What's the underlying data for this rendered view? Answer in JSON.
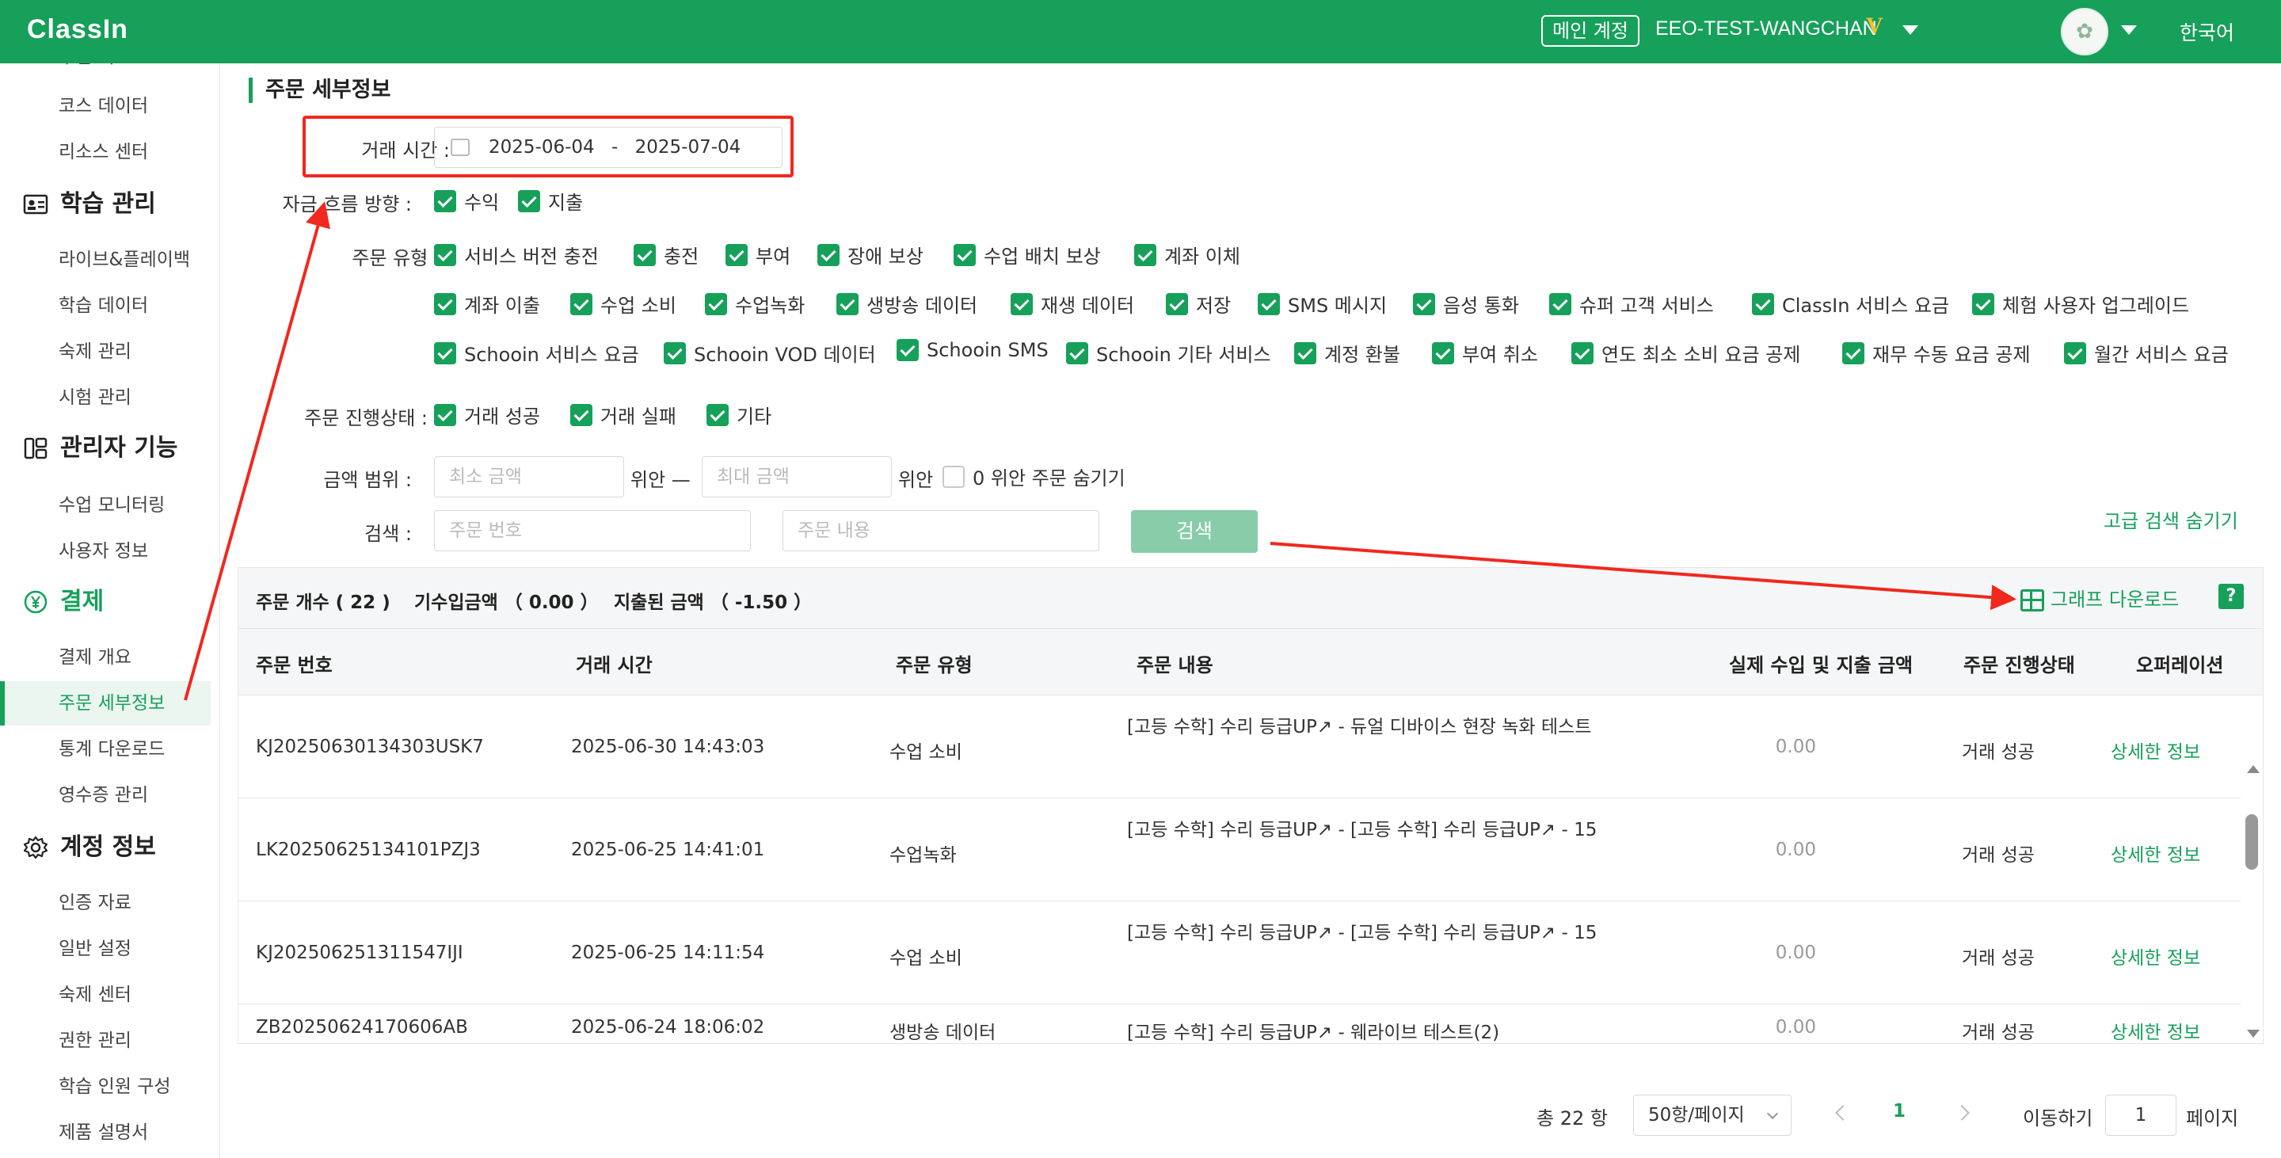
{
  "header": {
    "logo": "ClassIn",
    "main_account_badge": "메인 계정",
    "account_name": "EEO-TEST-WANGCHAN",
    "vip_badge": "V",
    "language": "한국어"
  },
  "sidebar": {
    "top_partial": "수업 리스트",
    "items_a": [
      "코스 데이터",
      "리소스 센터"
    ],
    "section_learning": "학습 관리",
    "items_learning": [
      "라이브&플레이백",
      "학습 데이터",
      "숙제 관리",
      "시험 관리"
    ],
    "section_admin": "관리자 기능",
    "items_admin": [
      "수업 모니터링",
      "사용자 정보"
    ],
    "section_payment": "결제",
    "items_payment": [
      "결제 개요",
      "주문 세부정보",
      "통계 다운로드",
      "영수증 관리"
    ],
    "section_account": "계정 정보",
    "items_account": [
      "인증 자료",
      "일반 설정",
      "숙제 센터",
      "권한 관리",
      "학습 인원 구성",
      "제품 설명서"
    ]
  },
  "filters": {
    "section_title": "주문 세부정보",
    "trade_time_label": "거래 시간 :",
    "date_start": "2025-06-04",
    "date_sep": "-",
    "date_end": "2025-07-04",
    "flow_label": "자금 흐름 방향 :",
    "flow_options": [
      "수익",
      "지출"
    ],
    "type_label": "주문 유형 :",
    "type_row1": [
      "서비스 버전 충전",
      "충전",
      "부여",
      "장애 보상",
      "수업 배치 보상",
      "계좌 이체"
    ],
    "type_row2": [
      "계좌 이출",
      "수업 소비",
      "수업녹화",
      "생방송 데이터",
      "재생 데이터",
      "저장",
      "SMS 메시지",
      "음성 통화",
      "슈퍼 고객 서비스",
      "ClassIn 서비스 요금",
      "체험 사용자 업그레이드"
    ],
    "type_row3": [
      "Schooin 서비스 요금",
      "Schooin VOD 데이터",
      "Schooin SMS",
      "Schooin 기타 서비스",
      "계정 환불",
      "부여 취소",
      "연도 최소 소비 요금 공제",
      "재무 수동 요금 공제",
      "월간 서비스 요금"
    ],
    "status_label": "주문 진행상태 :",
    "status_options": [
      "거래 성공",
      "거래 실패",
      "기타"
    ],
    "amount_label": "금액 범위 :",
    "min_placeholder": "최소 금액",
    "unit1": "위안 —",
    "max_placeholder": "최대 금액",
    "unit2": "위안",
    "hide_zero": "0 위안 주문 숨기기",
    "search_label": "검색 :",
    "order_no_placeholder": "주문 번호",
    "order_content_placeholder": "주문 내용",
    "search_button": "검색",
    "hide_advanced": "고급 검색 숨기기"
  },
  "summary": {
    "count": "주문 개수 ( 22 )",
    "prepaid": "기수입금액 （ 0.00 ）",
    "spent": "지출된 금액 （ -1.50 ）",
    "download": "그래프 다운로드",
    "help": "?"
  },
  "table": {
    "headers": [
      "주문 번호",
      "거래 시간",
      "주문 유형",
      "주문 내용",
      "실제 수입 및 지출 금액",
      "주문 진행상태",
      "오퍼레이션"
    ],
    "rows": [
      {
        "no": "KJ20250630134303USK7",
        "time": "2025-06-30 14:43:03",
        "type": "수업 소비",
        "content": "[고등 수학] 수리 등급UP↗ - 듀얼 디바이스 현장 녹화 테스트",
        "amount": "0.00",
        "status": "거래 성공",
        "op": "상세한 정보"
      },
      {
        "no": "LK20250625134101PZJ3",
        "time": "2025-06-25 14:41:01",
        "type": "수업녹화",
        "content": "[고등 수학] 수리 등급UP↗ - [고등 수학] 수리 등급UP↗ - 15",
        "amount": "0.00",
        "status": "거래 성공",
        "op": "상세한 정보"
      },
      {
        "no": "KJ202506251311547IJI",
        "time": "2025-06-25 14:11:54",
        "type": "수업 소비",
        "content": "[고등 수학] 수리 등급UP↗ - [고등 수학] 수리 등급UP↗ - 15",
        "amount": "0.00",
        "status": "거래 성공",
        "op": "상세한 정보"
      },
      {
        "no": "ZB20250624170606AB",
        "time": "2025-06-24 18:06:02",
        "type": "생방송 데이터",
        "content": "[고등 수학] 수리 등급UP↗ - 웨라이브 테스트(2)",
        "amount": "0.00",
        "status": "거래 성공",
        "op": "상세한 정보"
      }
    ]
  },
  "pagination": {
    "total": "총 22 항",
    "page_size": "50항/페이지",
    "current_page": "1",
    "goto_label": "이동하기",
    "goto_value": "1",
    "page_suffix": "페이지"
  },
  "colors": {
    "brand": "#16a05a",
    "annotation": "#f0281e"
  }
}
